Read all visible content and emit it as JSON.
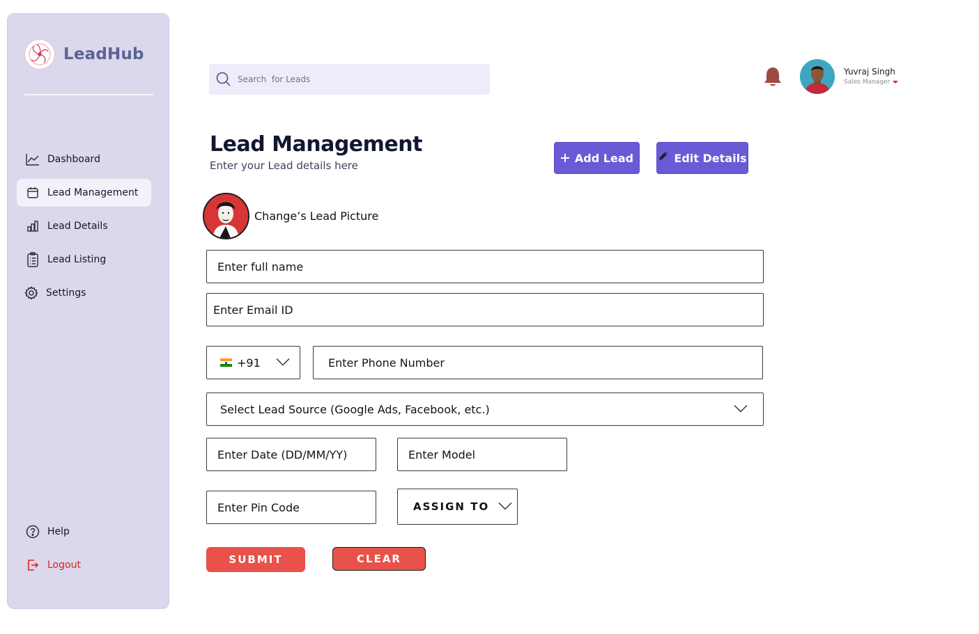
{
  "brand": {
    "name": "LeadHub"
  },
  "sidebar": {
    "items": [
      {
        "label": "Dashboard",
        "icon": "chart-line-icon",
        "active": false
      },
      {
        "label": "Lead Management",
        "icon": "calendar-icon",
        "active": true
      },
      {
        "label": "Lead Details",
        "icon": "bar-chart-icon",
        "active": false
      },
      {
        "label": "Lead Listing",
        "icon": "clipboard-list-icon",
        "active": false
      },
      {
        "label": "Settings",
        "icon": "gear-icon",
        "active": false
      }
    ],
    "bottom": [
      {
        "label": "Help",
        "icon": "help-circle-icon"
      },
      {
        "label": "Logout",
        "icon": "logout-icon",
        "color": "#e0201c"
      }
    ]
  },
  "search": {
    "placeholder": "Search  for Leads"
  },
  "user": {
    "name": "Yuvraj Singh",
    "role": "Sales Manager"
  },
  "header": {
    "title": "Lead Management",
    "subtitle": "Enter your Lead details here",
    "add_label": "Add Lead",
    "edit_label": "Edit Details"
  },
  "picture": {
    "label": "Change’s Lead Picture"
  },
  "form": {
    "name_placeholder": "Enter full name",
    "email_placeholder": "Enter Email ID",
    "country_code": "+91",
    "phone_placeholder": "Enter Phone Number",
    "source_placeholder": "Select Lead Source (Google Ads, Facebook, etc.)",
    "date_placeholder": "Enter Date (DD/MM/YY)",
    "model_placeholder": "Enter Model",
    "pin_placeholder": "Enter Pin Code",
    "assign_label": "ASSIGN TO",
    "submit_label": "SUBMIT",
    "clear_label": "CLEAR"
  },
  "colors": {
    "sidebar_bg": "#dcd8ec",
    "brand_text": "#5b6395",
    "primary_button": "#6a5ad6",
    "danger_button": "#e8524a",
    "search_bg": "#eeecfb"
  }
}
